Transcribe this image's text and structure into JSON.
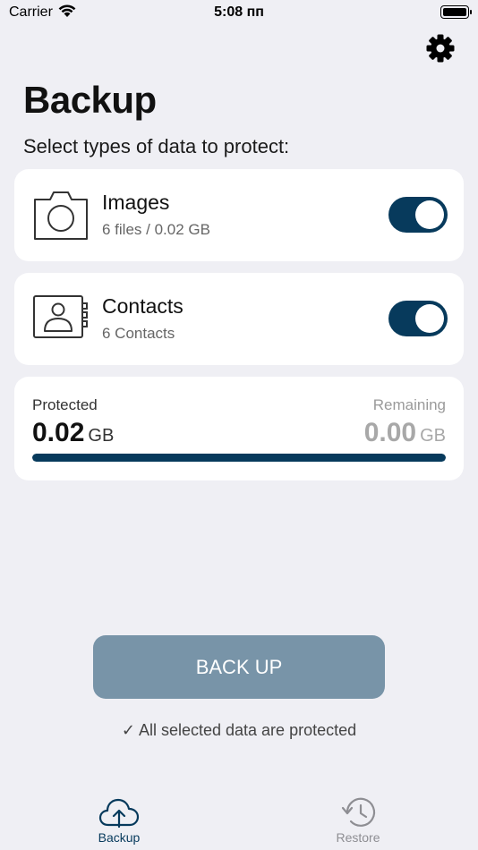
{
  "status_bar": {
    "carrier": "Carrier",
    "time": "5:08 пп"
  },
  "header": {
    "title": "Backup",
    "subtitle": "Select types of data to protect:",
    "settings_icon": "gear-icon"
  },
  "data_types": [
    {
      "name": "Images",
      "detail": "6 files / 0.02 GB",
      "icon": "camera-icon",
      "enabled": true
    },
    {
      "name": "Contacts",
      "detail": "6 Contacts",
      "icon": "contacts-book-icon",
      "enabled": true
    }
  ],
  "storage": {
    "protected_label": "Protected",
    "protected_value": "0.02",
    "protected_unit": "GB",
    "remaining_label": "Remaining",
    "remaining_value": "0.00",
    "remaining_unit": "GB",
    "progress_fraction": 1.0
  },
  "action": {
    "button_label": "BACK UP",
    "status_message": "✓ All selected data are protected"
  },
  "tabbar": [
    {
      "label": "Backup",
      "icon": "cloud-upload-icon",
      "active": true
    },
    {
      "label": "Restore",
      "icon": "history-icon",
      "active": false
    }
  ],
  "colors": {
    "accent": "#073a5c",
    "button": "#7894a8",
    "background": "#efeff4",
    "inactive": "#8e8e93"
  }
}
